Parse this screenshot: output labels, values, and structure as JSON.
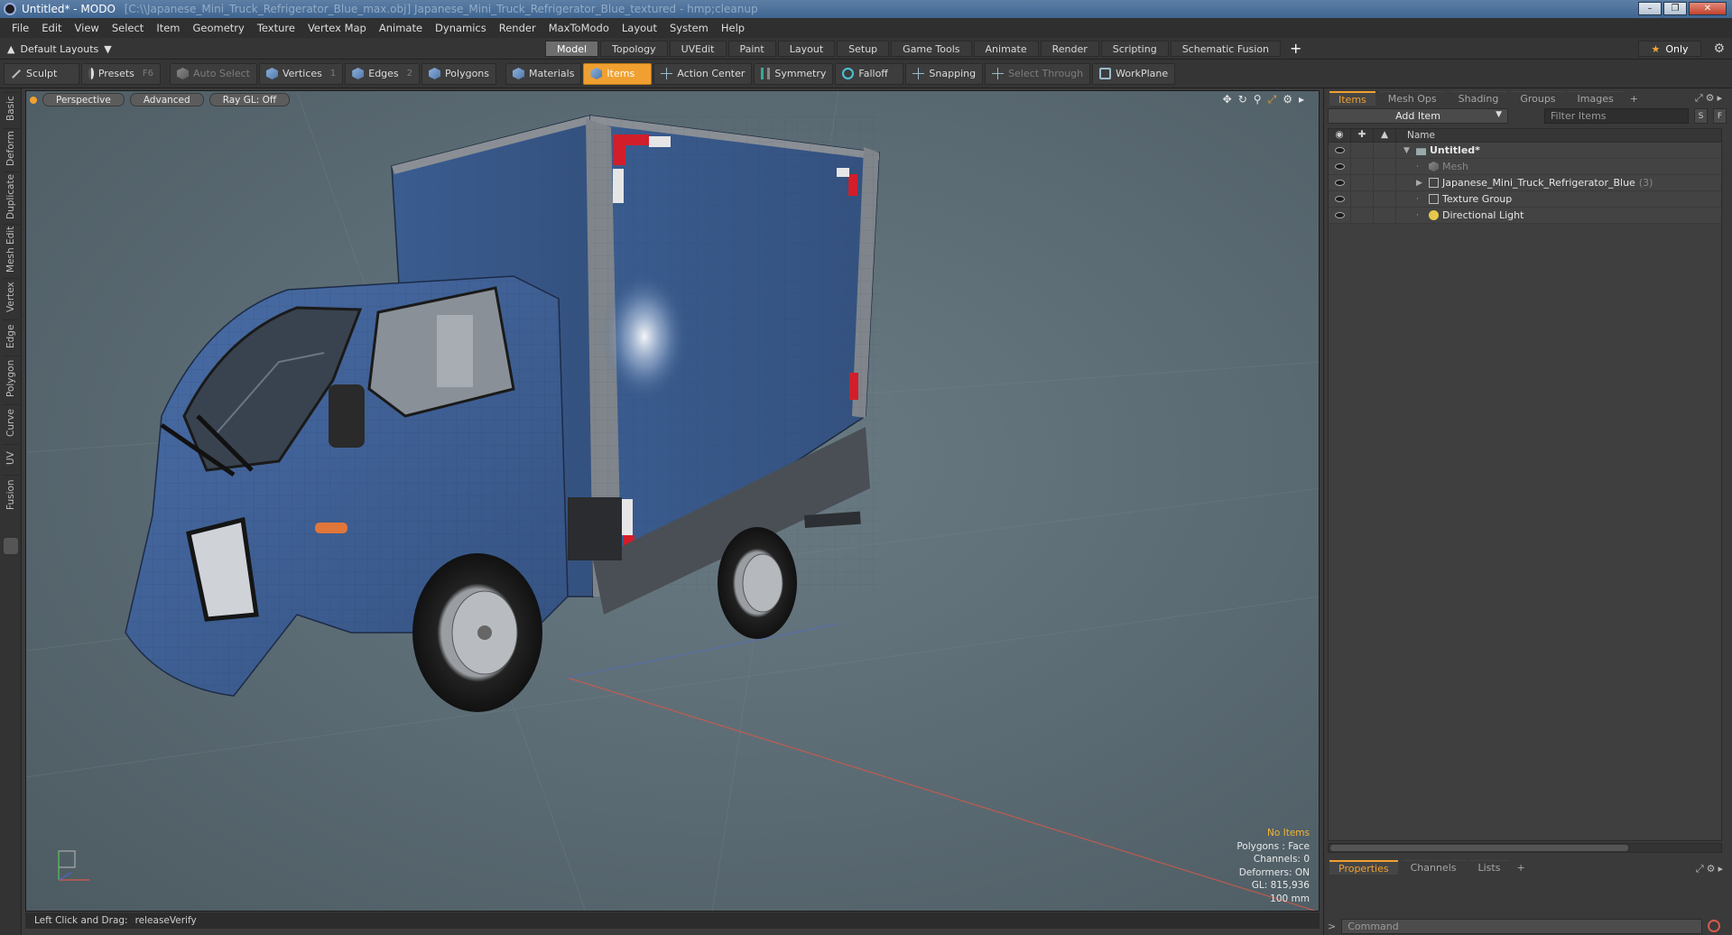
{
  "window": {
    "title": "Untitled* - MODO",
    "path_text": "[C:\\\\Japanese_Mini_Truck_Refrigerator_Blue_max.obj] Japanese_Mini_Truck_Refrigerator_Blue_textured - hmp;cleanup"
  },
  "menu": [
    "File",
    "Edit",
    "View",
    "Select",
    "Item",
    "Geometry",
    "Texture",
    "Vertex Map",
    "Animate",
    "Dynamics",
    "Render",
    "MaxToModo",
    "Layout",
    "System",
    "Help"
  ],
  "layout": {
    "dropdown_label": "Default Layouts",
    "tabs": [
      {
        "label": "Model",
        "active": true
      },
      {
        "label": "Topology",
        "active": false
      },
      {
        "label": "UVEdit",
        "active": false
      },
      {
        "label": "Paint",
        "active": false
      },
      {
        "label": "Layout",
        "active": false
      },
      {
        "label": "Setup",
        "active": false
      },
      {
        "label": "Game Tools",
        "active": false
      },
      {
        "label": "Animate",
        "active": false
      },
      {
        "label": "Render",
        "active": false
      },
      {
        "label": "Scripting",
        "active": false
      },
      {
        "label": "Schematic Fusion",
        "active": false
      }
    ],
    "add_symbol": "+",
    "only_label": "Only"
  },
  "toolbar": {
    "sculpt": "Sculpt",
    "presets": "Presets",
    "presets_hotkey": "F6",
    "auto_select": "Auto Select",
    "vertices": "Vertices",
    "vertices_hotkey": "1",
    "edges": "Edges",
    "edges_hotkey": "2",
    "polygons": "Polygons",
    "materials": "Materials",
    "items": "Items",
    "action_center": "Action Center",
    "symmetry": "Symmetry",
    "falloff": "Falloff",
    "snapping": "Snapping",
    "select_through": "Select Through",
    "workplane": "WorkPlane"
  },
  "left_tabs": [
    "Basic",
    "Deform",
    "Duplicate",
    "Mesh Edit",
    "Vertex",
    "Edge",
    "Polygon",
    "Curve",
    "UV",
    "Fusion"
  ],
  "viewport": {
    "view_label": "Perspective",
    "shading_label": "Advanced",
    "raygl_label": "Ray GL: Off",
    "info": {
      "no_items": "No Items",
      "polygons": "Polygons : Face",
      "channels": "Channels: 0",
      "deformers": "Deformers: ON",
      "gl": "GL: 815,936",
      "scale": "100 mm"
    }
  },
  "status": {
    "label": "Left Click and Drag:",
    "value": "releaseVerify"
  },
  "items_panel": {
    "tabs": [
      {
        "label": "Items",
        "active": true
      },
      {
        "label": "Mesh Ops",
        "active": false
      },
      {
        "label": "Shading",
        "active": false
      },
      {
        "label": "Groups",
        "active": false
      },
      {
        "label": "Images",
        "active": false
      }
    ],
    "add_item": "Add Item",
    "filter_placeholder": "Filter Items",
    "btn_s": "S",
    "btn_f": "F",
    "column_name": "Name",
    "tree": [
      {
        "label": "Untitled*",
        "level": 0,
        "expander": "▼",
        "bold": true,
        "dim": false,
        "count": ""
      },
      {
        "label": "Mesh",
        "level": 1,
        "expander": "",
        "bold": false,
        "dim": true,
        "count": ""
      },
      {
        "label": "Japanese_Mini_Truck_Refrigerator_Blue",
        "level": 1,
        "expander": "▶",
        "bold": false,
        "dim": false,
        "count": "(3)"
      },
      {
        "label": "Texture Group",
        "level": 1,
        "expander": "",
        "bold": false,
        "dim": false,
        "count": ""
      },
      {
        "label": "Directional Light",
        "level": 1,
        "expander": "",
        "bold": false,
        "dim": false,
        "count": ""
      }
    ]
  },
  "properties_panel": {
    "tabs": [
      {
        "label": "Properties",
        "active": true
      },
      {
        "label": "Channels",
        "active": false
      },
      {
        "label": "Lists",
        "active": false
      }
    ]
  },
  "command": {
    "placeholder": "Command"
  },
  "colors": {
    "accent": "#f0a030",
    "viewport_bg": "#5f6f77",
    "truck_blue": "#3c5f95"
  }
}
